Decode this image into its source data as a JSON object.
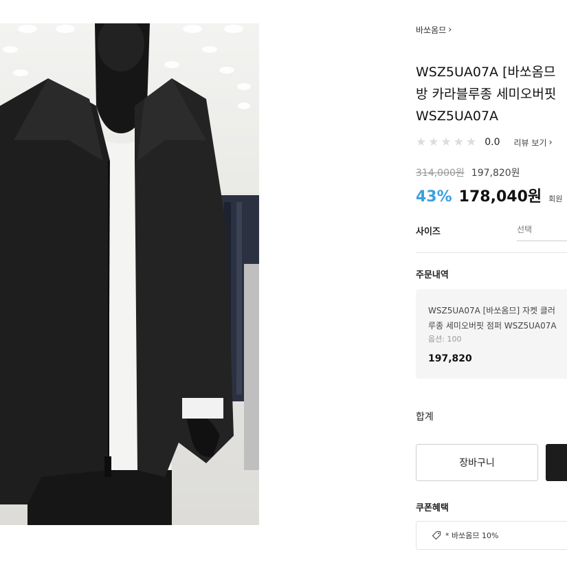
{
  "brand": {
    "name": "바쏘옴므",
    "chevron_icon": "chevron-right-icon"
  },
  "product": {
    "title_lines": [
      "WSZ5UA07A [바쏘옴므",
      "방 카라블루종 세미오버핏",
      "WSZ5UA07A"
    ],
    "image_icon": "jacket-mannequin-photo"
  },
  "rating": {
    "value": "0.0",
    "stars_filled": 0,
    "stars_total": 5,
    "review_link": "리뷰 보기"
  },
  "price": {
    "original": "314,000원",
    "sale": "197,820원",
    "member_discount": "43%",
    "member_price": "178,040원",
    "member_label": "회원"
  },
  "options": {
    "size_label": "사이즈",
    "size_placeholder": "선택"
  },
  "order": {
    "section_label": "주문내역",
    "item_name_lines": [
      "WSZ5UA07A [바쏘옴므] 자켓 클러",
      "루종 세미오버핏 점퍼 WSZ5UA07A"
    ],
    "option_text": "옵션: 100",
    "item_price": "197,820"
  },
  "total_label": "합계",
  "buttons": {
    "cart": "장바구니",
    "buy": ""
  },
  "coupon": {
    "section_label": "쿠폰혜택",
    "text": "* 바쏘옴므 10%",
    "icon": "tag-icon"
  },
  "colors": {
    "accent_discount": "#3aa0e0",
    "buy_button": "#1c1c1c",
    "order_box_bg": "#f5f5f5"
  }
}
